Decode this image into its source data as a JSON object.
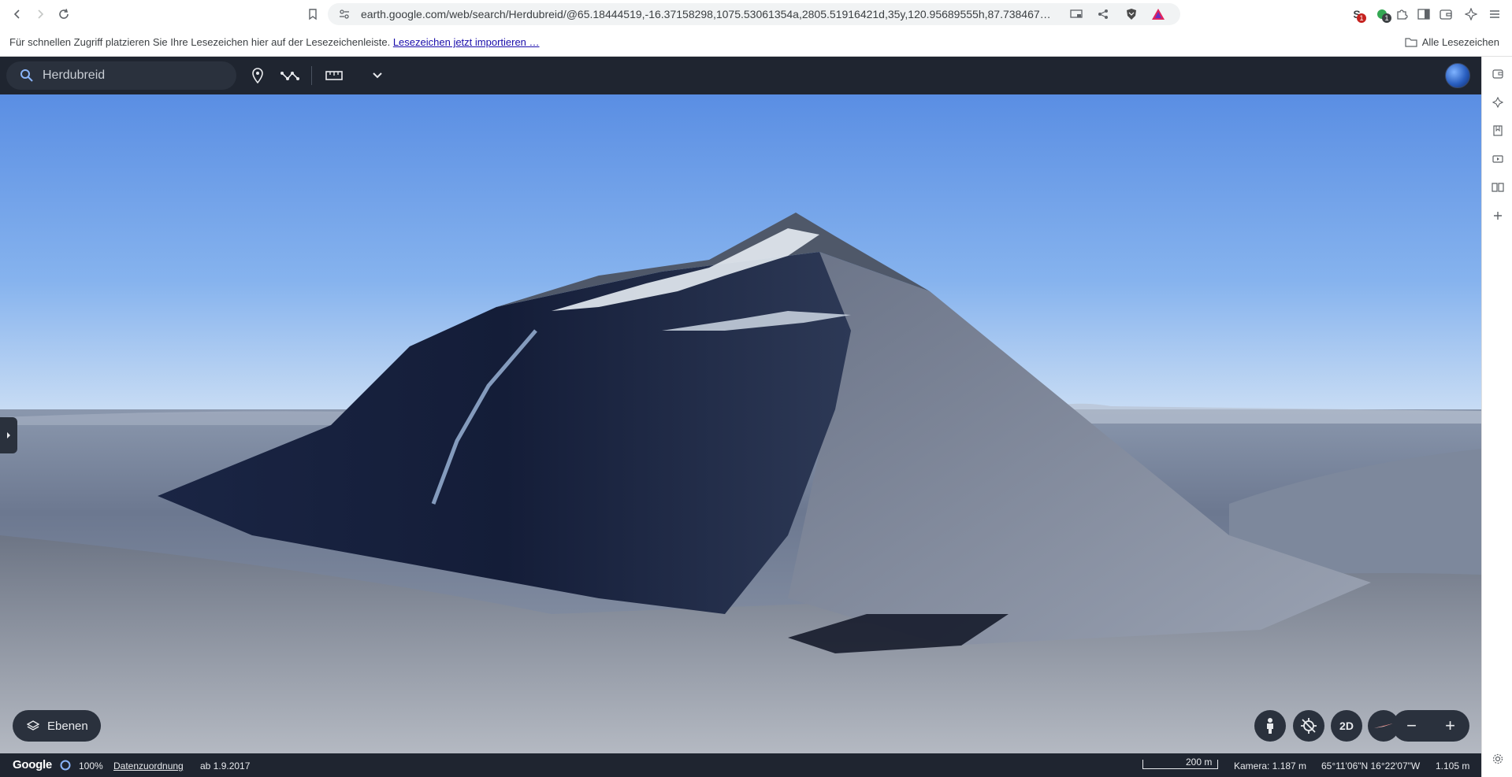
{
  "browser": {
    "url": "earth.google.com/web/search/Herdubreid/@65.18444519,-16.37158298,1075.53061354a,2805.51916421d,35y,120.95689555h,87.738467…",
    "extension_badges": [
      "1",
      "1"
    ]
  },
  "bookmarks_bar": {
    "prompt": "Für schnellen Zugriff platzieren Sie Ihre Lesezeichen hier auf der Lesezeichenleiste.",
    "import_link": "Lesezeichen jetzt importieren …",
    "all_bookmarks": "Alle Lesezeichen"
  },
  "earth": {
    "search": {
      "value": "Herdubreid",
      "placeholder": "Herdubreid"
    },
    "layers_label": "Ebenen",
    "controls": {
      "view_2d_label": "2D",
      "zoom_out": "−",
      "zoom_in": "+"
    },
    "status_bar": {
      "logo": "Google",
      "progress": "100%",
      "attribution": "Datenzuordnung",
      "imagery_date": "ab 1.9.2017",
      "scale": "200 m",
      "camera": "Kamera: 1.187 m",
      "coordinates": "65°11'06\"N 16°22'07\"W",
      "elevation": "1.105 m"
    }
  },
  "colors": {
    "earth_chrome": "#1f2530",
    "earth_control": "#2a313d",
    "sky_top": "#5b8fe0",
    "sky_horizon": "#cfe0f4"
  }
}
